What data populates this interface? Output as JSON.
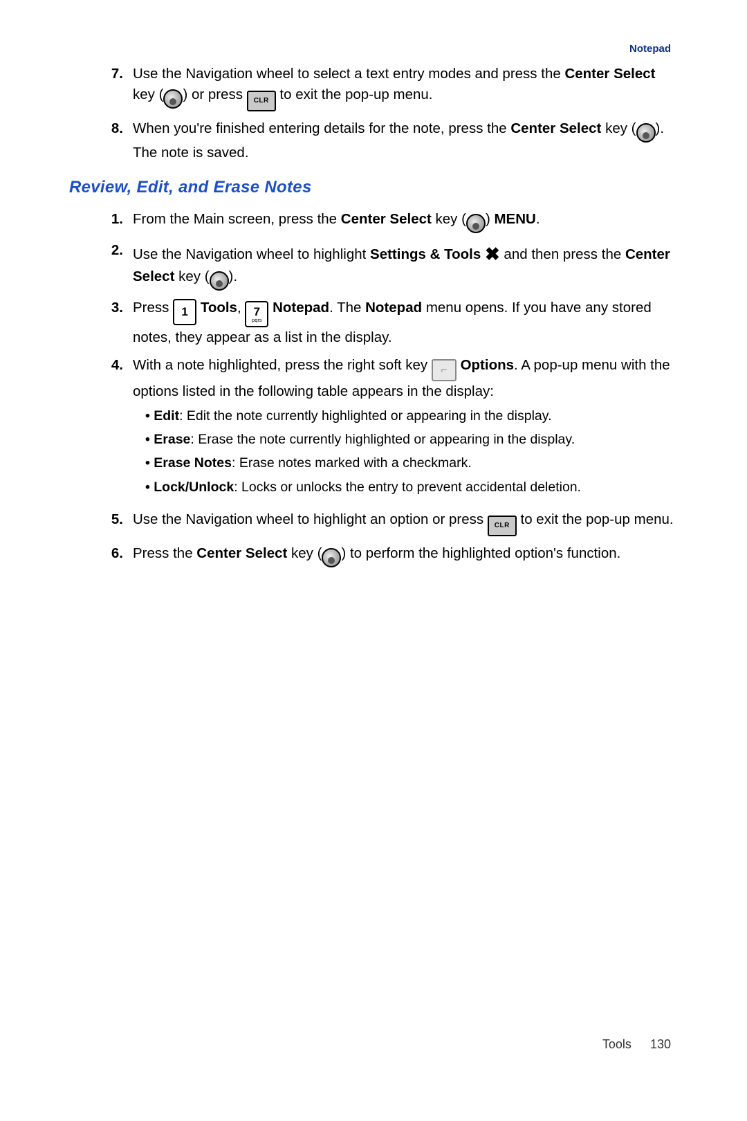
{
  "header": {
    "tag": "Notepad"
  },
  "top_list": [
    {
      "num": "7.",
      "parts": [
        {
          "t": "text",
          "v": "Use the Navigation wheel to select a text entry modes and press the "
        },
        {
          "t": "bold",
          "v": "Center Select"
        },
        {
          "t": "text",
          "v": " key ("
        },
        {
          "t": "center-key"
        },
        {
          "t": "text",
          "v": ") or press "
        },
        {
          "t": "clr-key"
        },
        {
          "t": "text",
          "v": " to exit the pop-up menu."
        }
      ]
    },
    {
      "num": "8.",
      "parts": [
        {
          "t": "text",
          "v": "When you're finished entering details for the note, press the "
        },
        {
          "t": "bold",
          "v": "Center Select"
        },
        {
          "t": "text",
          "v": " key ("
        },
        {
          "t": "center-key"
        },
        {
          "t": "text",
          "v": "). The note is saved."
        }
      ]
    }
  ],
  "section_title": "Review, Edit, and Erase Notes",
  "section_list": [
    {
      "num": "1.",
      "parts": [
        {
          "t": "text",
          "v": "From the Main screen, press the "
        },
        {
          "t": "bold",
          "v": "Center Select"
        },
        {
          "t": "text",
          "v": " key ("
        },
        {
          "t": "center-key"
        },
        {
          "t": "text",
          "v": ") "
        },
        {
          "t": "bold",
          "v": "MENU"
        },
        {
          "t": "text",
          "v": "."
        }
      ]
    },
    {
      "num": "2.",
      "parts": [
        {
          "t": "text",
          "v": "Use the Navigation wheel to highlight "
        },
        {
          "t": "bold",
          "v": "Settings & Tools"
        },
        {
          "t": "text",
          "v": " "
        },
        {
          "t": "tools-icon"
        },
        {
          "t": "text",
          "v": " and then press the "
        },
        {
          "t": "bold",
          "v": "Center Select"
        },
        {
          "t": "text",
          "v": " key ("
        },
        {
          "t": "center-key"
        },
        {
          "t": "text",
          "v": ")."
        }
      ]
    },
    {
      "num": "3.",
      "parts": [
        {
          "t": "text",
          "v": "Press "
        },
        {
          "t": "digit-key",
          "d": "1",
          "s": ""
        },
        {
          "t": "text",
          "v": " "
        },
        {
          "t": "bold",
          "v": "Tools"
        },
        {
          "t": "text",
          "v": ", "
        },
        {
          "t": "digit-key",
          "d": "7",
          "s": "pqrs"
        },
        {
          "t": "text",
          "v": " "
        },
        {
          "t": "bold",
          "v": "Notepad"
        },
        {
          "t": "text",
          "v": ". The "
        },
        {
          "t": "bold",
          "v": "Notepad"
        },
        {
          "t": "text",
          "v": " menu opens. If you have any stored notes, they appear as a list in the display."
        }
      ]
    },
    {
      "num": "4.",
      "parts": [
        {
          "t": "text",
          "v": "With a note highlighted, press the right soft key "
        },
        {
          "t": "soft-key"
        },
        {
          "t": "text",
          "v": " "
        },
        {
          "t": "bold",
          "v": "Options"
        },
        {
          "t": "text",
          "v": ". A pop-up menu with the options listed in the following table appears in the display:"
        }
      ],
      "bullets": [
        {
          "b": "Edit",
          "r": ": Edit the note currently highlighted or appearing in the display."
        },
        {
          "b": "Erase",
          "r": ": Erase the note currently highlighted or appearing in the display."
        },
        {
          "b": "Erase Notes",
          "r": ": Erase notes marked with a checkmark."
        },
        {
          "b": "Lock/Unlock",
          "r": ": Locks or unlocks the entry to prevent accidental deletion."
        }
      ]
    },
    {
      "num": "5.",
      "parts": [
        {
          "t": "text",
          "v": "Use the Navigation wheel to highlight an option or press "
        },
        {
          "t": "clr-key"
        },
        {
          "t": "text",
          "v": " to exit the pop-up menu."
        }
      ]
    },
    {
      "num": "6.",
      "parts": [
        {
          "t": "text",
          "v": "Press the "
        },
        {
          "t": "bold",
          "v": "Center Select"
        },
        {
          "t": "text",
          "v": " key ("
        },
        {
          "t": "center-key"
        },
        {
          "t": "text",
          "v": ") to perform the highlighted option's function."
        }
      ]
    }
  ],
  "footer": {
    "section": "Tools",
    "page": "130"
  },
  "icons": {
    "clr_label": "CLR",
    "soft_glyph": "⌐"
  }
}
